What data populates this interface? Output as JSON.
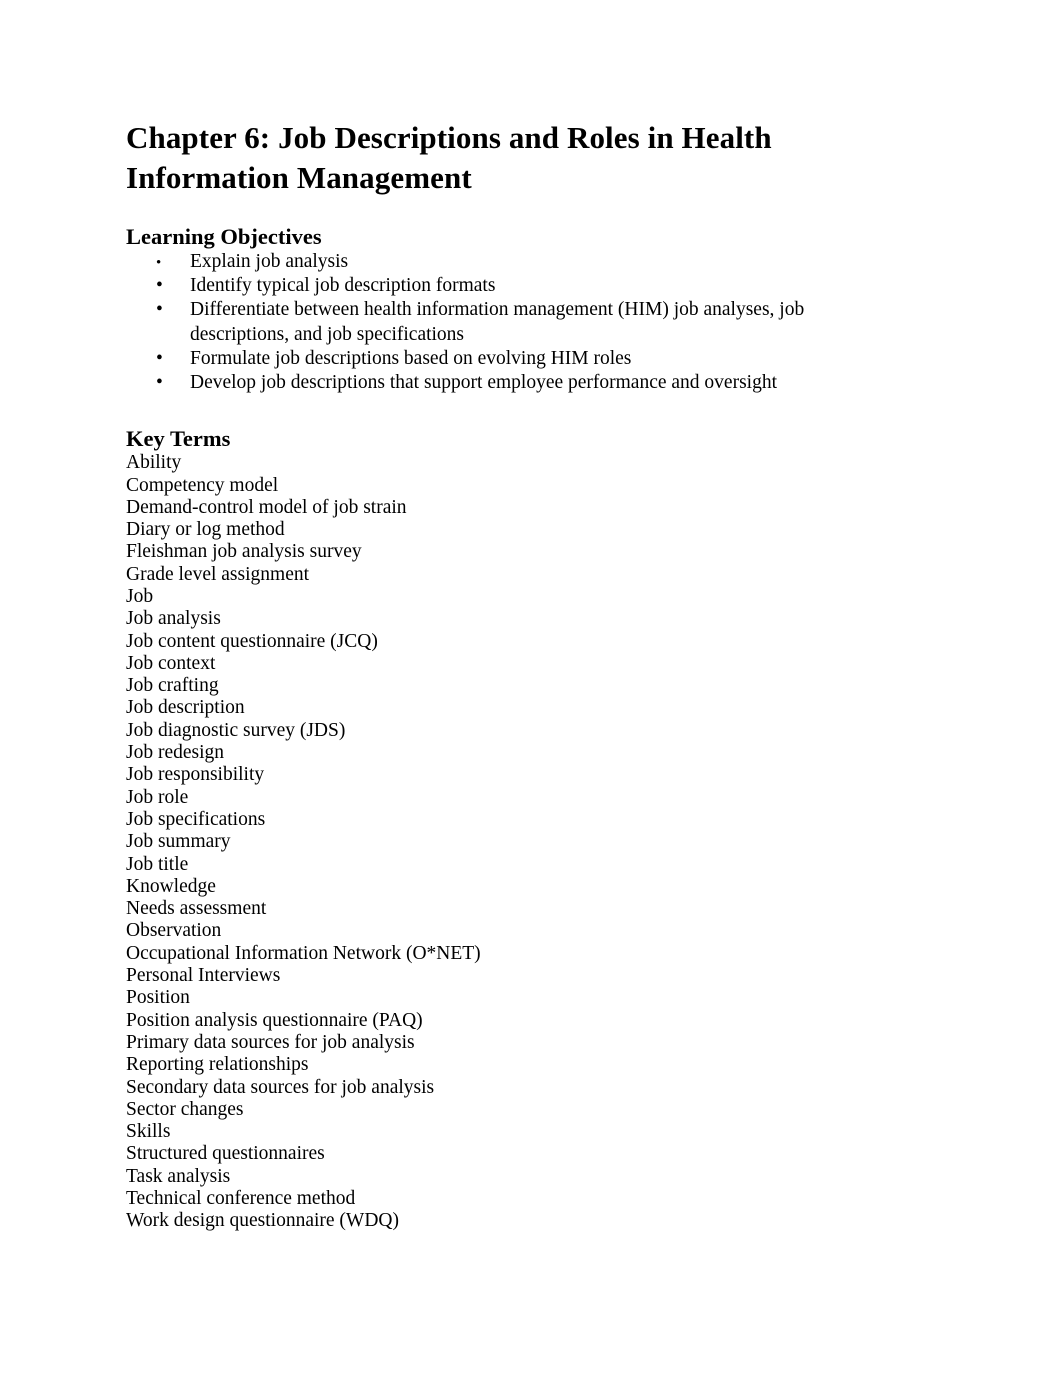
{
  "document": {
    "title": "Chapter 6: Job Descriptions and Roles in Health Information Management"
  },
  "learning_objectives": {
    "heading": "Learning Objectives",
    "bullet_glyph": "•",
    "items": [
      {
        "text": "Explain job analysis"
      },
      {
        "text": "Identify typical job description formats"
      },
      {
        "text": "Differentiate between health information management (HIM) job analyses, job descriptions, and job specifications"
      },
      {
        "text": "Formulate job descriptions based on evolving HIM roles"
      },
      {
        "text": "Develop job descriptions that support employee performance and oversight"
      }
    ]
  },
  "key_terms": {
    "heading": "Key Terms",
    "items": [
      {
        "term": "Ability"
      },
      {
        "term": "Competency model"
      },
      {
        "term": "Demand-control model of job strain"
      },
      {
        "term": "Diary or log method"
      },
      {
        "term": "Fleishman job analysis survey"
      },
      {
        "term": "Grade level assignment"
      },
      {
        "term": "Job"
      },
      {
        "term": "Job analysis"
      },
      {
        "term": "Job content questionnaire (JCQ)"
      },
      {
        "term": "Job context"
      },
      {
        "term": "Job crafting"
      },
      {
        "term": "Job description"
      },
      {
        "term": "Job diagnostic survey (JDS)"
      },
      {
        "term": "Job redesign"
      },
      {
        "term": "Job responsibility"
      },
      {
        "term": "Job role"
      },
      {
        "term": "Job specifications"
      },
      {
        "term": "Job summary"
      },
      {
        "term": "Job title"
      },
      {
        "term": "Knowledge"
      },
      {
        "term": "Needs assessment"
      },
      {
        "term": "Observation"
      },
      {
        "term": "Occupational Information Network (O*NET)"
      },
      {
        "term": "Personal Interviews"
      },
      {
        "term": "Position"
      },
      {
        "term": "Position analysis questionnaire (PAQ)"
      },
      {
        "term": "Primary data sources for job analysis"
      },
      {
        "term": "Reporting relationships"
      },
      {
        "term": "Secondary data sources for job analysis"
      },
      {
        "term": "Sector changes"
      },
      {
        "term": "Skills"
      },
      {
        "term": "Structured questionnaires"
      },
      {
        "term": "Task analysis"
      },
      {
        "term": "Technical conference method"
      },
      {
        "term": "Work design questionnaire (WDQ)"
      }
    ]
  },
  "theme": {
    "page_background": "#ffffff",
    "text_color": "#000000"
  }
}
